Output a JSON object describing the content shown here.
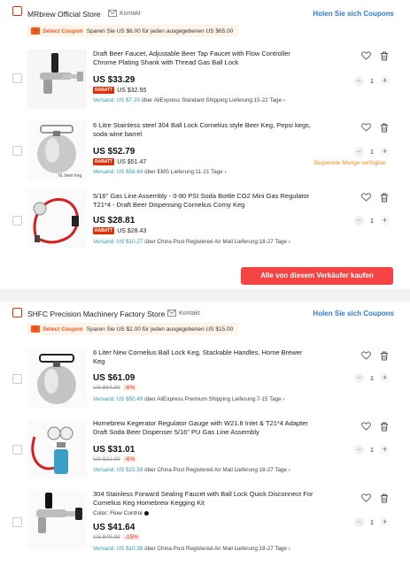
{
  "stores": [
    {
      "name": "MRbrew Official Store",
      "kontakt": "Kontakt",
      "coupons_link": "Holen Sie sich Coupons",
      "coupon": {
        "label": "Select Coupon",
        "text": "Sparen Sie US $6.00 für jeden ausgegebenen US $65.00"
      },
      "buy_all": "Alle von diesem Verkäufer kaufen",
      "items": [
        {
          "title": "Draft Beer Faucet, Adjustable Beer Tap Faucet with Flow Controller Chrome Plating Shank with Thread Gas Ball Lock",
          "price": "US $33.29",
          "rabatt": "RABATT",
          "rabatt_price": "US $32.55",
          "ship_label": "Versand: US $7.29",
          "ship_rest": "über AliExpress Standard Shipping  Lieferung:15-22 Tage",
          "qty": "1"
        },
        {
          "title": "6 Litre Stainless steel 304 Ball Lock Cornelius style Beer Keg, Pepsi kegs, soda wine barrel",
          "price": "US $52.79",
          "rabatt": "RABATT",
          "rabatt_price": "US $51.47",
          "ship_label": "Versand: US $58.64",
          "ship_rest": "über EMS  Lieferung:11-21 Tage",
          "qty": "1",
          "limit": "Begrenzte Menge verfügbar"
        },
        {
          "title": "5/16\" Gas Line Assembly - 0-90 PSI Soda Bottle CO2 Mini Gas Regulator T21*4 - Draft Beer Dispensing Cornelius Corny Keg",
          "price": "US $28.81",
          "rabatt": "RABATT",
          "rabatt_price": "US $28.43",
          "ship_label": "Versand: US $10.27",
          "ship_rest": "über China Post Registered Air Mail  Lieferung:18-27 Tage",
          "qty": "1"
        }
      ]
    },
    {
      "name": "SHFC Precision Machinery Factory Store",
      "kontakt": "Kontakt",
      "coupons_link": "Holen Sie sich Coupons",
      "coupon": {
        "label": "Select Coupon",
        "text": "Sparen Sie US $2.00 für jeden ausgegebenen US $15.00"
      },
      "items": [
        {
          "title": "6 Liter New Cornelius Ball Lock Keg, Stackable Handles, Home Brewer Keg",
          "price": "US $61.09",
          "old_price": "US $64.99",
          "discount": "-6%",
          "ship_label": "Versand: US $50.49",
          "ship_rest": "über AliExpress Premium Shipping  Lieferung:7-15 Tage",
          "qty": "1"
        },
        {
          "title": "Homebrew Kegerator Regulator Gauge with W21.8 Inlet & T21*4 Adapter Draft Soda Beer Dispenser 5/16\" PU Gas Line Assembly",
          "price": "US $31.01",
          "old_price": "US $32.99",
          "discount": "-6%",
          "ship_label": "Versand: US $22.59",
          "ship_rest": "über China Post Registered Air Mail  Lieferung:18-27 Tage",
          "qty": "1"
        },
        {
          "title": "304 Stainless Forward Sealing Faucet with Ball Lock Quick Disconnect For Cornelius Keg Homebrew Kegging Kit",
          "color_label": "Color: Flow Control",
          "price": "US $41.64",
          "old_price": "US $48.99",
          "discount": "-15%",
          "ship_label": "Versand: US $10.38",
          "ship_rest": "über China Post Registered Air Mail  Lieferung:18-27 Tage",
          "qty": "1"
        }
      ]
    }
  ],
  "icons": {
    "wishlist": "heart-icon",
    "delete": "trash-icon",
    "minus": "minus-icon",
    "plus": "plus-icon"
  },
  "colors": {
    "accent_red": "#e62e04",
    "buy_button": "#f64444",
    "link_blue": "#2e7bd6",
    "shipping_teal": "#2e9aa8",
    "coupon_orange": "#f5571c"
  }
}
